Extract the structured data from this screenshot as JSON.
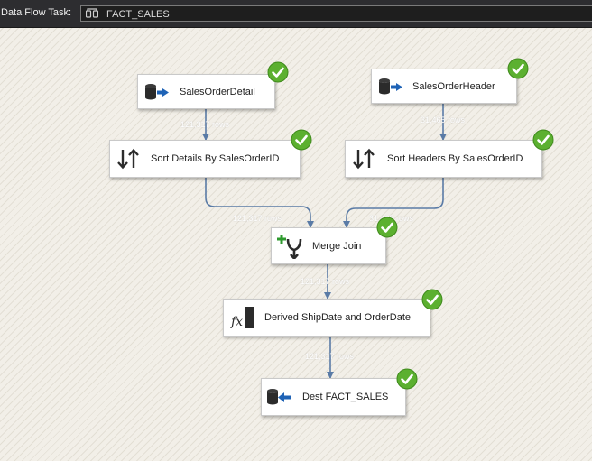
{
  "header": {
    "task_label": "Data Flow Task:",
    "task_name": "FACT_SALES"
  },
  "nodes": {
    "sales_order_detail": {
      "label": "SalesOrderDetail",
      "icon": "source-icon",
      "status": "success"
    },
    "sales_order_header": {
      "label": "SalesOrderHeader",
      "icon": "source-icon",
      "status": "success"
    },
    "sort_details": {
      "label": "Sort Details By SalesOrderID",
      "icon": "sort-icon",
      "status": "success"
    },
    "sort_headers": {
      "label": "Sort Headers By SalesOrderID",
      "icon": "sort-icon",
      "status": "success"
    },
    "merge_join": {
      "label": "Merge Join",
      "icon": "merge-join-icon",
      "status": "success"
    },
    "derived_column": {
      "label": "Derived ShipDate and OrderDate",
      "icon": "derived-column-icon",
      "status": "success"
    },
    "destination": {
      "label": "Dest FACT_SALES",
      "icon": "destination-icon",
      "status": "success"
    }
  },
  "colors": {
    "flow_line": "#5a7ba6",
    "success_check": "#5cb030",
    "arrow_blue": "#1f63b6",
    "icon_dark": "#2b2b2b"
  }
}
